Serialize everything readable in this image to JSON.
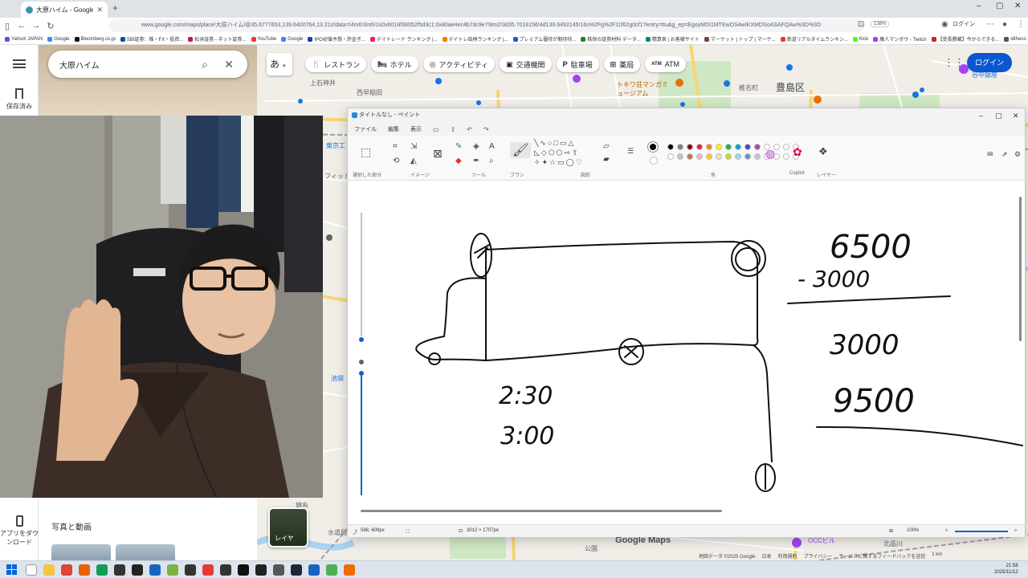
{
  "browser": {
    "tab_title": "大原ハイム - Google マップ",
    "url": "www.google.com/maps/place/大原ハイム/@35.6777653,139.6400764,13.21z/data=!4m6!3m5!1s0x6018f38052f5d3c1:0x80ae4ec4b7dc9e7!8m2!3d35.7018156!4d139.6492145!16s%2Fg%2F11f62g0cf1?entry=ttu&g_ep=EgoyMDI1MTEwOS4wIKXMDSoASAFQAw%3D%3D",
    "zoom": "138%",
    "login": "ログイン",
    "bookmarks": [
      "Yahoo! JAPAN",
      "Google",
      "Bloomberg.co.jp",
      "SBI証券：株・FX・投資...",
      "松井証券 - ネット証券...",
      "YouTube",
      "Google",
      "IPO初値予想・許金子...",
      "デイトレード ランキング |...",
      "デイトレ銘柄ランキング |...",
      "プレミアム優待が期待待...",
      "株探の証券材料 データ...",
      "精算表 | お客様サイト",
      "マーケット | トップ | マーケ...",
      "鉄道リアルタイムランキン...",
      "Kick",
      "魔人マンボウ - Twitch",
      "【受長勝蔵】今からできる...",
      "idtheco"
    ]
  },
  "maps": {
    "search_value": "大原ハイム",
    "saved_label": "保存済み",
    "app_download_label": "アプリをダウンロード",
    "ime_label": "あ",
    "chips": [
      {
        "icon": "fork-knife-icon",
        "glyph": "🍴",
        "label": "レストラン"
      },
      {
        "icon": "bed-icon",
        "glyph": "🛏",
        "label": "ホテル"
      },
      {
        "icon": "camera-icon",
        "glyph": "◎",
        "label": "アクティビティ"
      },
      {
        "icon": "train-icon",
        "glyph": "▣",
        "label": "交通機関"
      },
      {
        "icon": "parking-icon",
        "glyph": "P",
        "label": "駐車場"
      },
      {
        "icon": "pharmacy-icon",
        "glyph": "⊞",
        "label": "薬局"
      },
      {
        "icon": "atm-icon",
        "glyph": "ATM",
        "label": "ATM"
      }
    ],
    "login": "ログイン",
    "photos_label": "写真と動画",
    "layers_label": "レイヤ",
    "logo": "Google Maps",
    "attribution": [
      "地図データ ©2025 Google",
      "日本",
      "利用規約",
      "プライバシー",
      "サービスに関するフィードバックを送信",
      "1 km"
    ],
    "map_labels": {
      "ward": "豊島区",
      "shiinamachi": "椎名町",
      "tokiwaso": "トキワ荘マンガミュージアム",
      "yanakaginza": "谷中銀座",
      "nishiwaseda": "西早稲田",
      "ishigamii": "上石神井",
      "tokyo_univ": "東京工",
      "fit": "フィット",
      "ikebukuro_area": "池袋",
      "kinshicho": "錦糸",
      "suido": "水道局",
      "omiya": "公園",
      "occ": "OCCビル",
      "kita": "北品川"
    }
  },
  "paint": {
    "title": "タイトルなし - ペイント",
    "menu": [
      "ファイル",
      "編集",
      "表示"
    ],
    "groups": {
      "selection": "選択した部分",
      "image": "イメージ",
      "tools": "ツール",
      "brush": "ブラシ",
      "shapes": "図形",
      "colors": "色",
      "copilot": "Copilot",
      "layers": "レイヤー"
    },
    "palette_colors": [
      "#000000",
      "#7f7f7f",
      "#880015",
      "#ed1c24",
      "#ff7f27",
      "#fff200",
      "#22b14c",
      "#00a2e8",
      "#3f48cc",
      "#a349a4"
    ],
    "palette_colors_2": [
      "#ffffff",
      "#c3c3c3",
      "#b97a57",
      "#ffaec9",
      "#ffc90e",
      "#efe4b0",
      "#b5e61d",
      "#99d9ea",
      "#7092be",
      "#c8bfe7"
    ],
    "status": {
      "cursor": "598, 609px",
      "canvas_size": "3012 × 1707px",
      "zoom": "100%"
    },
    "handwriting": {
      "top_value": "6500",
      "minus_value": "- 3000",
      "result_value": "3000",
      "sum_value": "9500",
      "time_1": "2:30",
      "time_2": "3:00"
    }
  },
  "taskbar": {
    "time": "21:58",
    "date": "2025/11/12"
  }
}
